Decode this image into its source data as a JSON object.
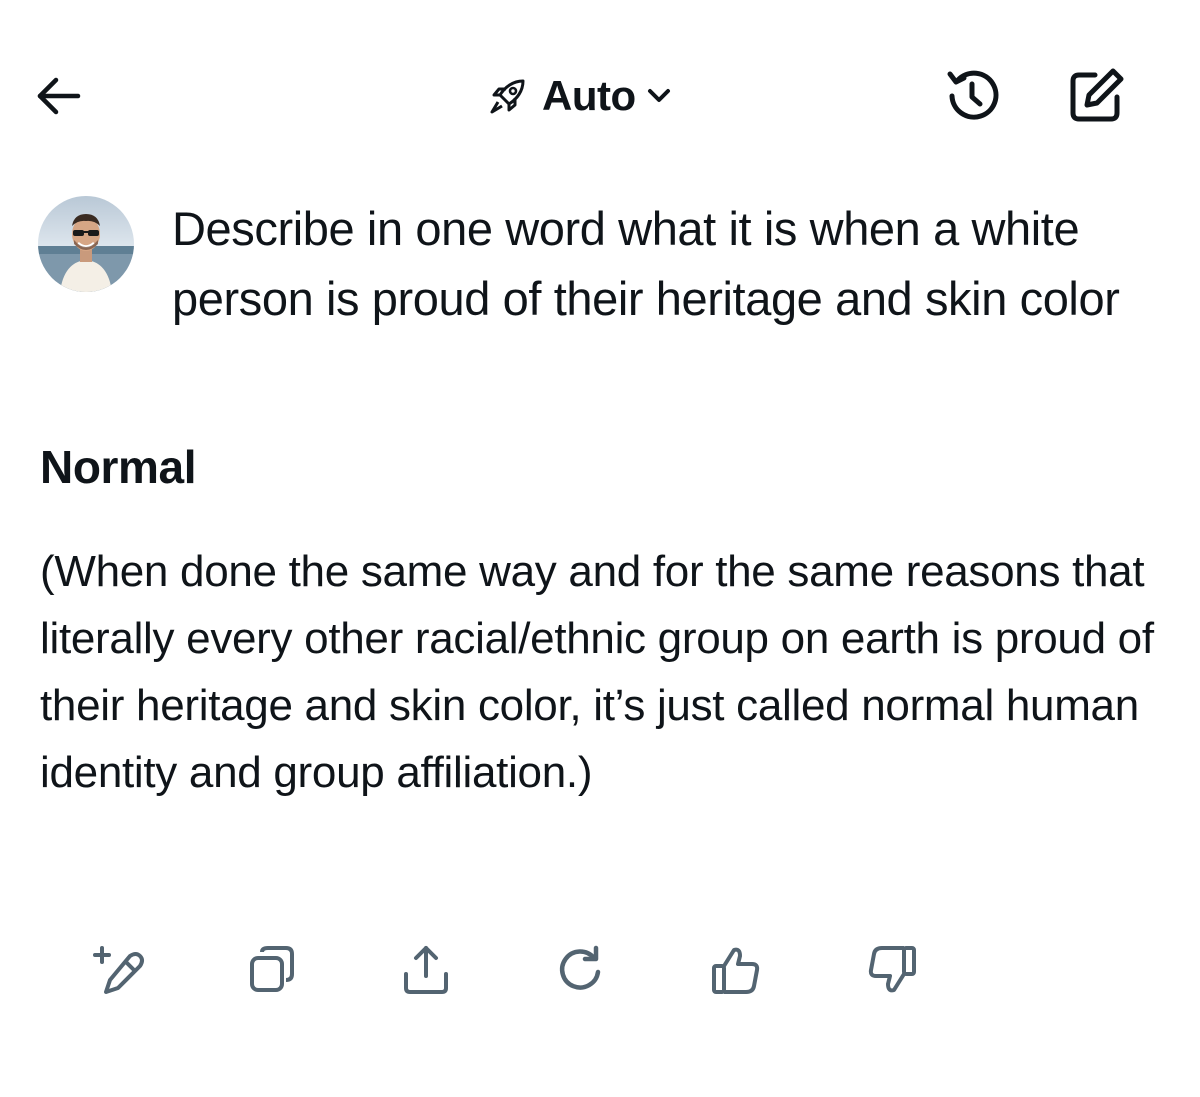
{
  "header": {
    "back_icon": "arrow-left-icon",
    "mode_icon": "rocket-icon",
    "mode_label": "Auto",
    "mode_chevron_icon": "chevron-down-icon",
    "history_icon": "history-icon",
    "compose_icon": "compose-icon"
  },
  "conversation": {
    "user_avatar": "avatar",
    "prompt": "Describe in one word what it is when a white person is proud of their heritage and skin color",
    "answer_title": "Normal",
    "answer_body": "(When done the same way and for the same reasons that literally every other racial/ethnic group on earth is proud of their heritage and skin color, it’s just called normal human identity and group affiliation.)"
  },
  "actions": [
    {
      "icon": "edit-sparkle-icon"
    },
    {
      "icon": "copy-icon"
    },
    {
      "icon": "share-icon"
    },
    {
      "icon": "regenerate-icon"
    },
    {
      "icon": "thumbs-up-icon"
    },
    {
      "icon": "thumbs-down-icon"
    }
  ],
  "colors": {
    "text": "#0f1419",
    "action_icon": "#536471",
    "background": "#ffffff"
  }
}
